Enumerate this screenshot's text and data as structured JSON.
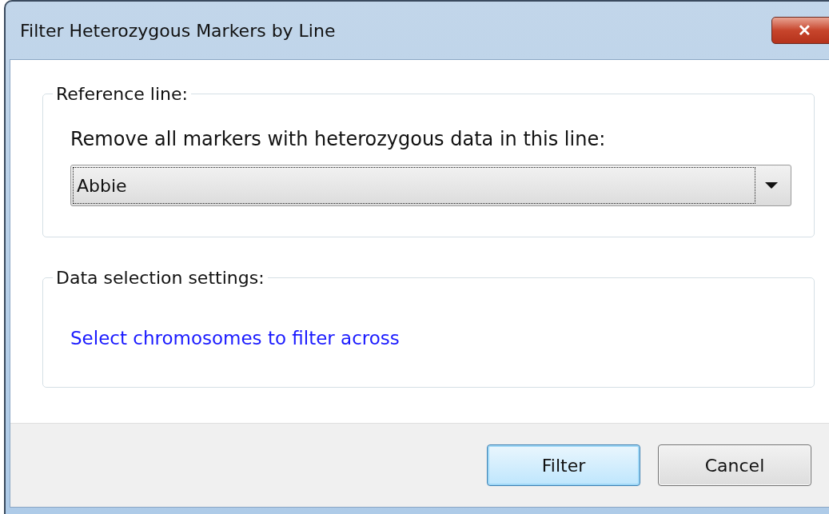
{
  "window": {
    "title": "Filter Heterozygous Markers by Line",
    "close_label": "✕"
  },
  "reference_group": {
    "legend": "Reference line:",
    "prompt": "Remove all markers with heterozygous data in this line:",
    "dropdown": {
      "value": "Abbie",
      "focused": true
    }
  },
  "data_group": {
    "legend": "Data selection settings:",
    "link": "Select chromosomes to filter across"
  },
  "buttons": [
    {
      "label": "Filter",
      "default": true
    },
    {
      "label": "Cancel",
      "default": false
    }
  ]
}
